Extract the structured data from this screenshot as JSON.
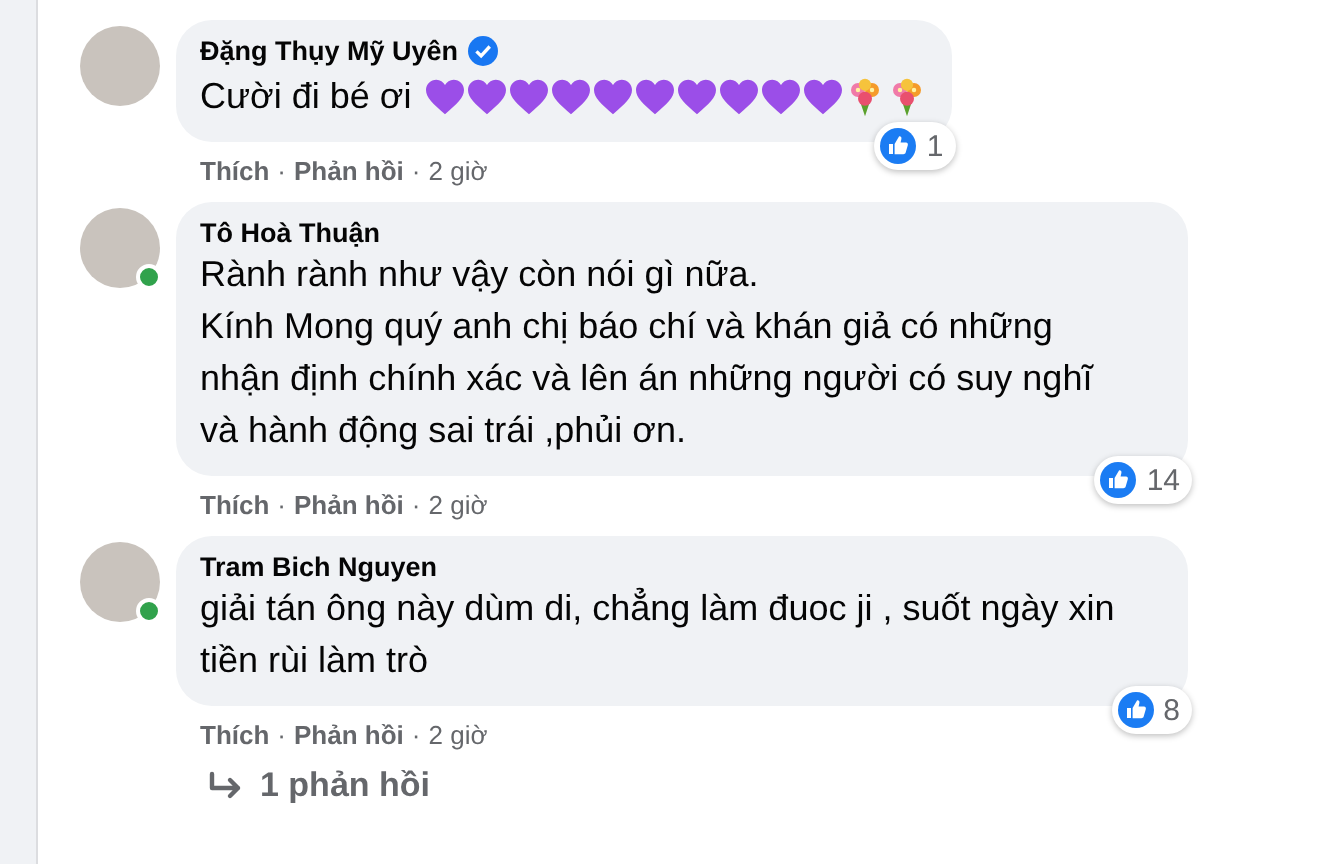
{
  "comments": [
    {
      "author": "Đặng Thụy Mỹ Uyên",
      "verified": true,
      "online": false,
      "text": "Cười đi bé ơi",
      "emojis": [
        {
          "kind": "heart"
        },
        {
          "kind": "heart"
        },
        {
          "kind": "heart"
        },
        {
          "kind": "heart"
        },
        {
          "kind": "heart"
        },
        {
          "kind": "heart"
        },
        {
          "kind": "heart"
        },
        {
          "kind": "heart"
        },
        {
          "kind": "heart"
        },
        {
          "kind": "heart"
        },
        {
          "kind": "bouquet"
        },
        {
          "kind": "bouquet"
        }
      ],
      "likes": "1",
      "actions": [
        {
          "kind": "link",
          "text": "Thích"
        },
        {
          "kind": "separator",
          "text": "·"
        },
        {
          "kind": "link",
          "text": "Phản hồi"
        },
        {
          "kind": "separator",
          "text": "·"
        },
        {
          "kind": "time",
          "text": "2 giờ"
        }
      ]
    },
    {
      "author": "Tô Hoà Thuận",
      "verified": false,
      "online": true,
      "text": "Rành rành như vậy còn nói gì nữa.\nKính Mong quý anh chị báo chí và khán giả có những nhận định chính xác và lên án những người có suy nghĩ và hành động sai trái ,phủi ơn.",
      "likes": "14",
      "actions": [
        {
          "kind": "link",
          "text": "Thích"
        },
        {
          "kind": "separator",
          "text": "·"
        },
        {
          "kind": "link",
          "text": "Phản hồi"
        },
        {
          "kind": "separator",
          "text": "·"
        },
        {
          "kind": "time",
          "text": "2 giờ"
        }
      ]
    },
    {
      "author": "Tram Bich Nguyen",
      "verified": false,
      "online": true,
      "text": "giải tán ông này dùm di, chẳng làm đuoc ji , suốt ngày xin tiền rùi làm trò",
      "likes": "8",
      "actions": [
        {
          "kind": "link",
          "text": "Thích"
        },
        {
          "kind": "separator",
          "text": "·"
        },
        {
          "kind": "link",
          "text": "Phản hồi"
        },
        {
          "kind": "separator",
          "text": "·"
        },
        {
          "kind": "time",
          "text": "2 giờ"
        }
      ]
    }
  ],
  "replies_link": "1 phản hồi"
}
